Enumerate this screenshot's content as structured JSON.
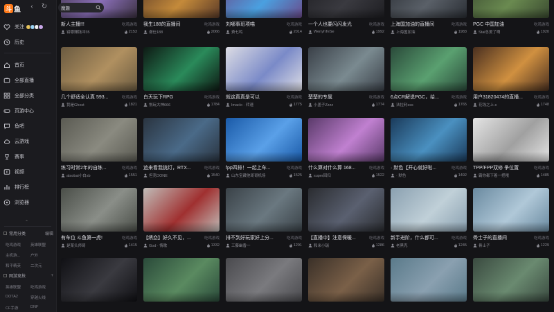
{
  "app": {
    "logo_badge": "斗",
    "logo_text": "鱼"
  },
  "nav": {
    "back_glyph": "‹",
    "refresh_glyph": "↻"
  },
  "search": {
    "value": "魔趣"
  },
  "sidebar": {
    "follow": "关注",
    "history": "历史",
    "items": [
      "首页",
      "全部直播",
      "全部分类",
      "页游中心",
      "鱼吧",
      "云游戏",
      "赛事",
      "视频",
      "排行榜",
      "浏览器"
    ],
    "common": {
      "title": "常用分类",
      "link": "编辑",
      "cats": [
        "吃鸡游戏",
        "英雄联盟",
        "主机游...",
        "户外",
        "和平精英",
        "二次元"
      ]
    },
    "network": {
      "title": "网游竞技",
      "cats": [
        "英雄联盟",
        "吃鸡游戏",
        "DOTA2",
        "穿越火线",
        "CF手游",
        "DNF"
      ]
    },
    "colors": [
      "#e6c35c",
      "#9bd3f5",
      "#f0f0f0",
      "#c9a7e8"
    ]
  },
  "cards": [
    {
      "title": "新人主播!!!",
      "cat": "吃鸡游戏",
      "streamer": "钳哪赚钱冲35",
      "viewers": "2153",
      "bg": "#3a3040",
      "acc": "#8a6fb8"
    },
    {
      "title": "我生188的直播间",
      "cat": "吃鸡游戏",
      "streamer": "谢仕188",
      "viewers": "2066",
      "bg": "#5a3a28",
      "acc": "#c48a3a"
    },
    {
      "title": "刘哪事班项喵",
      "cat": "吃鸡游戏",
      "streamer": "费七鸣",
      "viewers": "2014",
      "bg": "#6a4a8a",
      "acc": "#4aa0e0"
    },
    {
      "title": "一个人也要闪闪发光",
      "cat": "吃鸡游戏",
      "streamer": "WenyhTeSe",
      "viewers": "1992",
      "bg": "#1e1e22",
      "acc": "#3a3a40"
    },
    {
      "title": "上海国加油的直播间",
      "cat": "吃鸡游戏",
      "streamer": "上海国加油",
      "viewers": "1983",
      "bg": "#2a2e34",
      "acc": "#5a6068"
    },
    {
      "title": "PGC 中国加油",
      "cat": "吃鸡游戏",
      "streamer": "Stai总爱了啊",
      "viewers": "1920",
      "bg": "#3a4a30",
      "acc": "#6a8a50"
    },
    {
      "title": "几个舒适全认真 593...",
      "cat": "吃鸡游戏",
      "streamer": "我是Ghost",
      "viewers": "1821",
      "bg": "#6a5a40",
      "acc": "#b09060"
    },
    {
      "title": "白天玩下RPG",
      "cat": "吃鸡游戏",
      "streamer": "悦玩大神666",
      "viewers": "1784",
      "bg": "#0e1a14",
      "acc": "#2a8a5a"
    },
    {
      "title": "就这真真是可以",
      "cat": "吃鸡游戏",
      "streamer": "Imaclo · 转速",
      "viewers": "1775",
      "bg": "#dcdce4",
      "acc": "#7a8ac8"
    },
    {
      "title": "楚楚的专属",
      "cat": "吃鸡游戏",
      "streamer": "小盖子Zzzz",
      "viewers": "1774",
      "bg": "#3a4048",
      "acc": "#7a8a90"
    },
    {
      "title": "6点CR解说PGC，给...",
      "cat": "吃鸡游戏",
      "streamer": "法拉利sss",
      "viewers": "1765",
      "bg": "#2a4a3a",
      "acc": "#5aa070"
    },
    {
      "title": "用户31820474的直播...",
      "cat": "吃鸡游戏",
      "streamer": "花钱之上.s",
      "viewers": "1748",
      "bg": "#4a3020",
      "acc": "#d09040"
    },
    {
      "title": "练习时常2年的自练...",
      "cat": "吃鸡游戏",
      "streamer": "alaobai小白sb",
      "viewers": "1551",
      "bg": "#5a5a52",
      "acc": "#8a8a80"
    },
    {
      "title": "追来看我挑灯，RTX...",
      "cat": "吃鸡游戏",
      "streamer": "坦克DONE",
      "viewers": "1540",
      "bg": "#2a3440",
      "acc": "#4a6a88"
    },
    {
      "title": "fpp四排！一起上车...",
      "cat": "吃鸡游戏",
      "streamer": "山东宝藏他哥哥机场",
      "viewers": "1525",
      "bg": "#1a5aa8",
      "acc": "#5aa0e8"
    },
    {
      "title": "什么算对什么算 168...",
      "cat": "吃鸡游戏",
      "streamer": "super回归",
      "viewers": "1522",
      "bg": "#5a3a6a",
      "acc": "#c080d0"
    },
    {
      "title": "· 默色【开心就好啦...",
      "cat": "吃鸡游戏",
      "streamer": "· 默色",
      "viewers": "1492",
      "bg": "#1a3a5a",
      "acc": "#4a90c0"
    },
    {
      "title": "TPP/FPP双修 争位置",
      "cat": "吃鸡游戏",
      "streamer": "霸你都下着一把哦",
      "viewers": "1485",
      "bg": "#e4e4e4",
      "acc": "#a0a0a0"
    },
    {
      "title": "有车位 斗鱼第一虎!",
      "cat": "吃鸡游戏",
      "streamer": "是某头师哥",
      "viewers": "1415",
      "bg": "#4a4e48",
      "acc": "#8a8e88"
    },
    {
      "title": "【绣恋】好久不见，...",
      "cat": "吃鸡游戏",
      "streamer": "God · 情歌",
      "viewers": "1332",
      "bg": "#c0bcb8",
      "acc": "#a03030"
    },
    {
      "title": "排不到好玩家好上分...",
      "cat": "吃鸡游戏",
      "streamer": "工藤幽香一",
      "viewers": "1291",
      "bg": "#3a4248",
      "acc": "#6a7880"
    },
    {
      "title": "【直播中】注意保暖...",
      "cat": "吃鸡游戏",
      "streamer": "和米小瑞",
      "viewers": "1286",
      "bg": "#2a2c30",
      "acc": "#5a6070"
    },
    {
      "title": "新手进阶，什么都可...",
      "cat": "吃鸡游戏",
      "streamer": "老黑克",
      "viewers": "1245",
      "bg": "#8aa0b0",
      "acc": "#c0d0d8"
    },
    {
      "title": "骨士子的直播间",
      "cat": "吃鸡游戏",
      "streamer": "骨士子",
      "viewers": "1229",
      "bg": "#6a8aa0",
      "acc": "#b0c8d8"
    },
    {
      "title": "",
      "cat": "",
      "streamer": "",
      "viewers": "",
      "bg": "#101014",
      "acc": "#3a3a40"
    },
    {
      "title": "",
      "cat": "",
      "streamer": "",
      "viewers": "",
      "bg": "#2a4a3a",
      "acc": "#5a8a60"
    },
    {
      "title": "",
      "cat": "",
      "streamer": "",
      "viewers": "",
      "bg": "#4a4a4e",
      "acc": "#7a7a7e"
    },
    {
      "title": "",
      "cat": "",
      "streamer": "",
      "viewers": "",
      "bg": "#3a3028",
      "acc": "#7a6048"
    },
    {
      "title": "",
      "cat": "",
      "streamer": "",
      "viewers": "",
      "bg": "#5a7a8a",
      "acc": "#8aa0b0"
    },
    {
      "title": "",
      "cat": "",
      "streamer": "",
      "viewers": "",
      "bg": "#3a4a40",
      "acc": "#6a8a70"
    }
  ]
}
